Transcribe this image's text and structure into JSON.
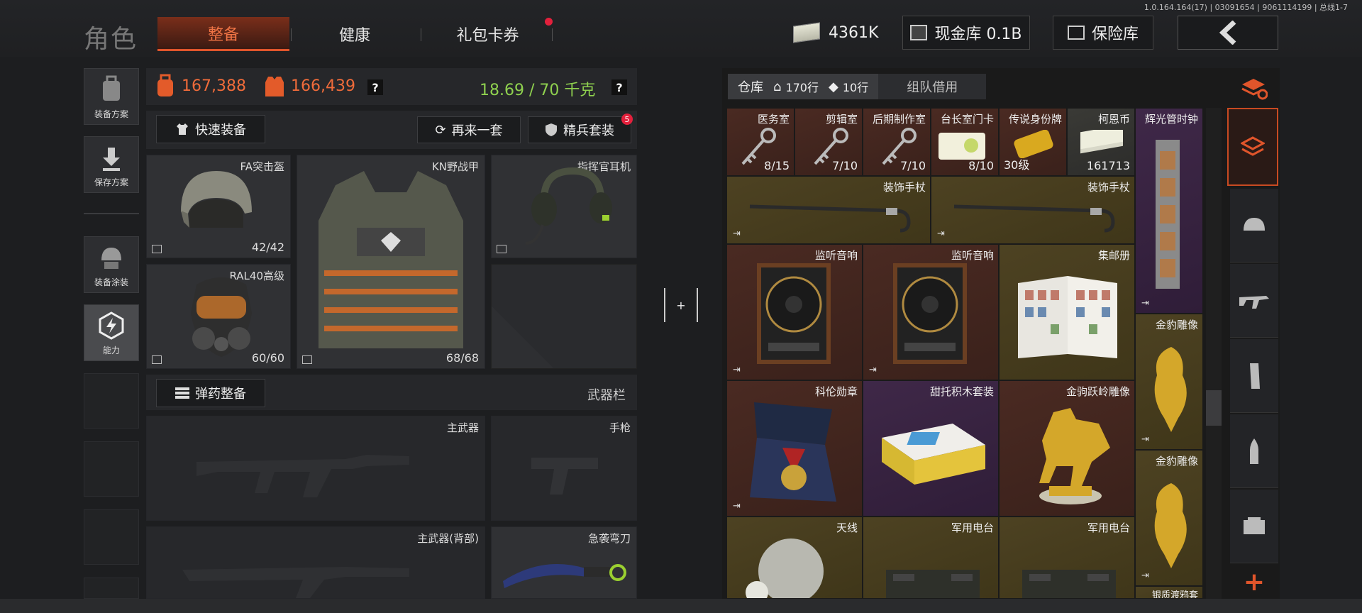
{
  "version": "1.0.164.164(17) | 03091654 | 9061114199 | 总线1-7",
  "header": {
    "title": "角色",
    "tabs": [
      {
        "label": "整备",
        "active": true
      },
      {
        "label": "健康",
        "active": false
      },
      {
        "label": "礼包卡券",
        "active": false,
        "has_notification": true
      }
    ],
    "cash": "4361K",
    "cash_vault": "现金库 0.1B",
    "safe_vault": "保险库"
  },
  "sidebar": {
    "items": [
      {
        "label": "装备方案",
        "icon": "backpack-icon"
      },
      {
        "label": "保存方案",
        "icon": "download-icon"
      },
      {
        "label": "装备涂装",
        "icon": "helmet-paint-icon"
      },
      {
        "label": "能力",
        "icon": "lightning-icon",
        "active": true
      }
    ]
  },
  "loadout": {
    "value_equipped": "167,388",
    "value_vest": "166,439",
    "weight": "18.69 / 70 千克",
    "help": "?",
    "quick_equip": "快速装备",
    "reequip": "再来一套",
    "elite_set": "精兵套装",
    "elite_badge": "5",
    "ammo_prep": "弹药整备",
    "weapon_bar": "武器栏",
    "slots": {
      "helmet": {
        "name": "FA突击盔",
        "durability": "42/42"
      },
      "armor": {
        "name": "KN野战甲",
        "durability": "68/68"
      },
      "headset": {
        "name": "指挥官耳机"
      },
      "mask": {
        "name": "RAL40高级",
        "durability": "60/60"
      }
    },
    "weapons": {
      "primary": "主武器",
      "pistol": "手枪",
      "primary_back": "主武器(背部)",
      "melee": "急袭弯刀"
    }
  },
  "warehouse": {
    "tab_label": "仓库",
    "rows": "170行",
    "tickets": "10行",
    "team_borrow": "组队借用",
    "items": [
      {
        "name": "医务室",
        "count": "8/15"
      },
      {
        "name": "剪辑室",
        "count": "7/10"
      },
      {
        "name": "后期制作室",
        "count": "7/10"
      },
      {
        "name": "台长室门卡",
        "count": "8/10"
      },
      {
        "name": "传说身份牌",
        "count": "30级"
      },
      {
        "name": "柯恩币",
        "count": "161713"
      },
      {
        "name": "辉光管时钟"
      },
      {
        "name": "装饰手杖"
      },
      {
        "name": "装饰手杖"
      },
      {
        "name": "监听音响"
      },
      {
        "name": "监听音响"
      },
      {
        "name": "集邮册"
      },
      {
        "name": "金豹雕像"
      },
      {
        "name": "科伦勋章"
      },
      {
        "name": "甜托积木套装"
      },
      {
        "name": "金驹跃岭雕像"
      },
      {
        "name": "金豹雕像"
      },
      {
        "name": "天线"
      },
      {
        "name": "军用电台"
      },
      {
        "name": "军用电台"
      },
      {
        "name": "银质渡鸦套"
      }
    ]
  },
  "center_toggle": "+",
  "colors": {
    "accent": "#e0552b",
    "weight_green": "#8fd14f",
    "rarity_red": "#4a2a22",
    "rarity_gold": "#4d4222",
    "rarity_purple": "#3f2848"
  }
}
